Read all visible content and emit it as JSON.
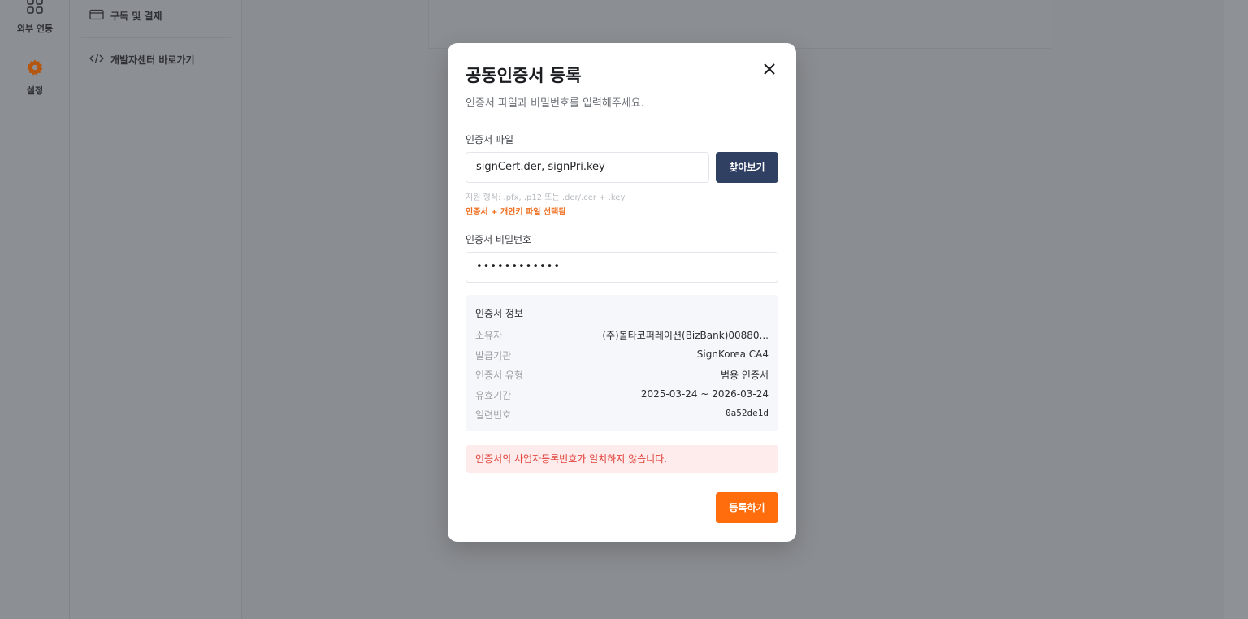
{
  "rail": {
    "items": [
      {
        "label": "외부 연동",
        "icon": "grid-icon"
      },
      {
        "label": "설정",
        "icon": "gear-icon"
      }
    ]
  },
  "sub_nav": {
    "items": [
      {
        "label": "구독 및 결제",
        "icon": "credit-card-icon"
      },
      {
        "label": "개발자센터 바로가기",
        "icon": "code-icon"
      }
    ]
  },
  "modal": {
    "title": "공동인증서 등록",
    "description": "인증서 파일과 비밀번호를 입력해주세요.",
    "file_label": "인증서 파일",
    "file_value": "signCert.der, signPri.key",
    "browse_label": "찾아보기",
    "file_hint": "지원 형식: .pfx, .p12 또는 .der/.cer + .key",
    "file_selected_note": "인증서 + 개인키 파일 선택됨",
    "password_label": "인증서 비밀번호",
    "password_value": "••••••••••••",
    "info": {
      "title": "인증서 정보",
      "rows": [
        {
          "key": "소유자",
          "value": "(주)볼타코퍼레이션(BizBank)00880..."
        },
        {
          "key": "발급기관",
          "value": "SignKorea CA4"
        },
        {
          "key": "인증서 유형",
          "value": "범용 인증서"
        },
        {
          "key": "유효기간",
          "value": "2025-03-24 ~ 2026-03-24"
        },
        {
          "key": "일련번호",
          "value": "0a52de1d"
        }
      ]
    },
    "error_message": "인증서의 사업자등록번호가 일치하지 않습니다.",
    "submit_label": "등록하기"
  },
  "colors": {
    "accent": "#ff6d0d",
    "navy": "#2f4063",
    "error": "#e2423b",
    "overlay": "#8a8d91"
  }
}
